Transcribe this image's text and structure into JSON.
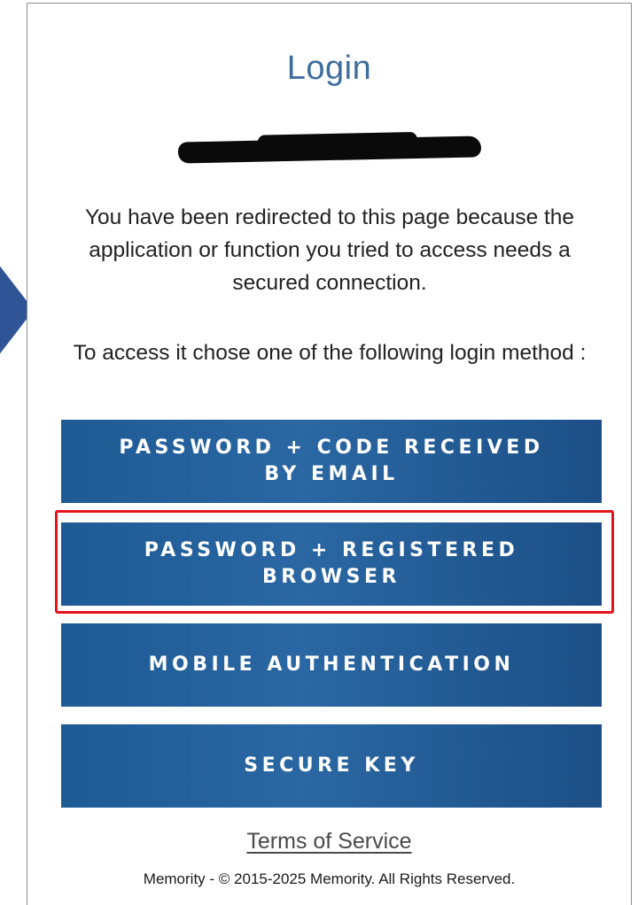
{
  "login": {
    "title": "Login",
    "redirect_message": "You have been redirected to this page because the application or function you tried to access needs a secured connection.",
    "choose_message": "To access it chose one of the following login method :"
  },
  "methods": [
    {
      "label": "PASSWORD + CODE RECEIVED BY EMAIL"
    },
    {
      "label": "PASSWORD + REGISTERED BROWSER"
    },
    {
      "label": "MOBILE AUTHENTICATION"
    },
    {
      "label": "SECURE KEY"
    }
  ],
  "footer": {
    "terms_label": "Terms of Service",
    "copyright": "Memority - © 2015-2025 Memority. All Rights Reserved."
  },
  "colors": {
    "title": "#3d6d9c",
    "button": "#2a67a3",
    "highlight": "#e3141b",
    "arrow": "#2f5597"
  },
  "annotations": {
    "highlighted_method_index": 1
  }
}
